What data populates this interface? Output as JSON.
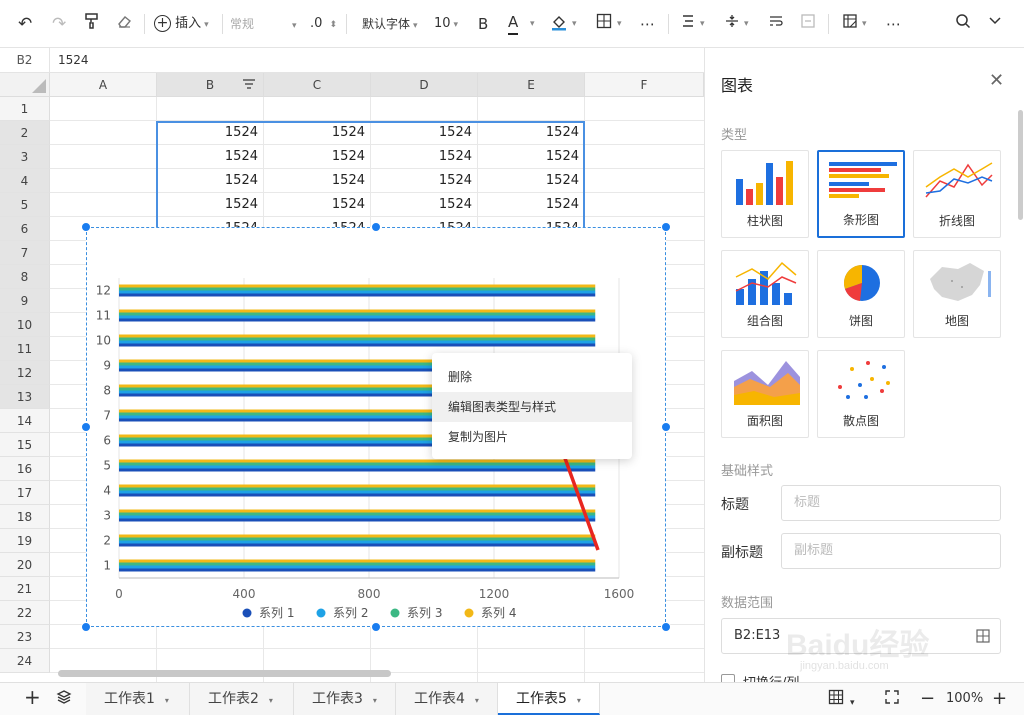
{
  "toolbar": {
    "insert_label": "插入",
    "format_value": "常规",
    "decimal_label": ".0",
    "font_name": "默认字体",
    "font_size": "10",
    "bold_label": "B",
    "font_color_label": "A"
  },
  "formula_bar": {
    "cell_ref": "B2",
    "value": "1524"
  },
  "grid": {
    "columns": [
      "A",
      "B",
      "C",
      "D",
      "E",
      "F"
    ],
    "rows": [
      "1",
      "2",
      "3",
      "4",
      "5",
      "6",
      "7",
      "8",
      "9",
      "10",
      "11",
      "12",
      "13",
      "14",
      "15",
      "16",
      "17",
      "18",
      "19",
      "20",
      "21",
      "22",
      "23",
      "24"
    ],
    "cell_value": "1524"
  },
  "chart_data": {
    "type": "bar",
    "orientation": "horizontal",
    "categories": [
      "1",
      "2",
      "3",
      "4",
      "5",
      "6",
      "7",
      "8",
      "9",
      "10",
      "11",
      "12"
    ],
    "series": [
      {
        "name": "系列 1",
        "color": "#1a4fb8",
        "values": [
          1524,
          1524,
          1524,
          1524,
          1524,
          1524,
          1524,
          1524,
          1524,
          1524,
          1524,
          1524
        ]
      },
      {
        "name": "系列 2",
        "color": "#1ea2e6",
        "values": [
          1524,
          1524,
          1524,
          1524,
          1524,
          1524,
          1524,
          1524,
          1524,
          1524,
          1524,
          1524
        ]
      },
      {
        "name": "系列 3",
        "color": "#3cb884",
        "values": [
          1524,
          1524,
          1524,
          1524,
          1524,
          1524,
          1524,
          1524,
          1524,
          1524,
          1524,
          1524
        ]
      },
      {
        "name": "系列 4",
        "color": "#f2b817",
        "values": [
          1524,
          1524,
          1524,
          1524,
          1524,
          1524,
          1524,
          1524,
          1524,
          1524,
          1524,
          1524
        ]
      }
    ],
    "x_ticks": [
      "0",
      "400",
      "800",
      "1200",
      "1600"
    ],
    "xlim": [
      0,
      1600
    ],
    "grid": true,
    "legend_position": "bottom"
  },
  "context_menu": {
    "delete": "删除",
    "edit_chart": "编辑图表类型与样式",
    "copy_as_image": "复制为图片"
  },
  "panel": {
    "title": "图表",
    "type_section": "类型",
    "chart_types": {
      "bar": "柱状图",
      "hbar": "条形图",
      "line": "折线图",
      "combo": "组合图",
      "pie": "饼图",
      "map": "地图",
      "area": "面积图",
      "scatter": "散点图"
    },
    "style_section": "基础样式",
    "title_label": "标题",
    "title_placeholder": "标题",
    "subtitle_label": "副标题",
    "subtitle_placeholder": "副标题",
    "range_section": "数据范围",
    "range_value": "B2:E13",
    "switch_label": "切换行/列"
  },
  "sheets": [
    "工作表1",
    "工作表2",
    "工作表3",
    "工作表4",
    "工作表5"
  ],
  "zoom": "100%",
  "watermark": "Baidu经验",
  "watermark_url": "jingyan.baidu.com",
  "colors": {
    "accent": "#1a6fd9",
    "arrow": "#e8261f"
  }
}
